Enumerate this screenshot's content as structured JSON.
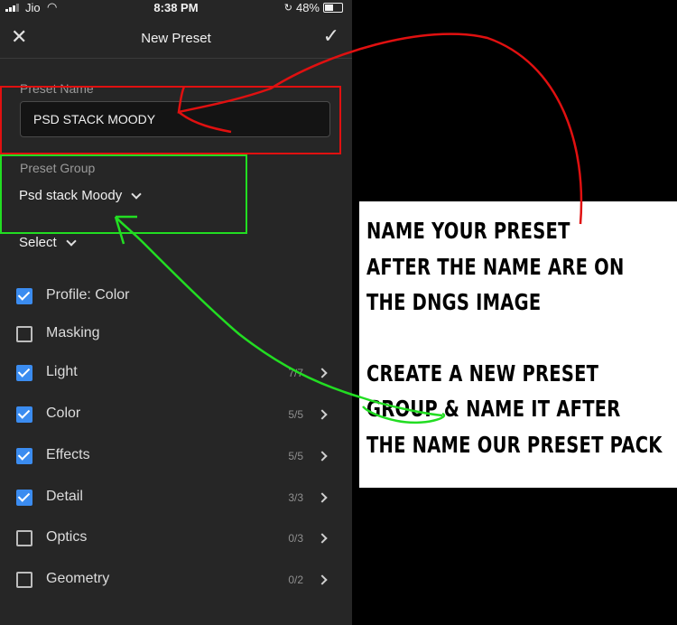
{
  "status_bar": {
    "carrier": "Jio",
    "time": "8:38 PM",
    "battery": "48%",
    "battery_level": 0.48
  },
  "header": {
    "title": "New Preset",
    "close_icon": "close-icon",
    "confirm_icon": "checkmark-icon"
  },
  "preset_name": {
    "label": "Preset Name",
    "value": "PSD STACK MOODY"
  },
  "preset_group": {
    "label": "Preset Group",
    "value": "Psd stack Moody"
  },
  "select": {
    "label": "Select"
  },
  "settings": [
    {
      "label": "Profile: Color",
      "checked": true,
      "count": ""
    },
    {
      "label": "Masking",
      "checked": false,
      "count": ""
    },
    {
      "label": "Light",
      "checked": true,
      "count": "7/7"
    },
    {
      "label": "Color",
      "checked": true,
      "count": "5/5"
    },
    {
      "label": "Effects",
      "checked": true,
      "count": "5/5"
    },
    {
      "label": "Detail",
      "checked": true,
      "count": "3/3"
    },
    {
      "label": "Optics",
      "checked": false,
      "count": "0/3"
    },
    {
      "label": "Geometry",
      "checked": false,
      "count": "0/2"
    }
  ],
  "annotation": {
    "lines": [
      "NAME YOUR PRESET",
      "AFTER THE NAME ARE ON",
      "THE DNGS IMAGE",
      "CREATE A NEW PRESET",
      "GROUP & NAME IT AFTER",
      "THE NAME OUR PRESET PACK"
    ]
  },
  "colors": {
    "accent_checkbox": "#3b8cf0",
    "highlight_red": "#e01010",
    "highlight_green": "#22dd22"
  }
}
